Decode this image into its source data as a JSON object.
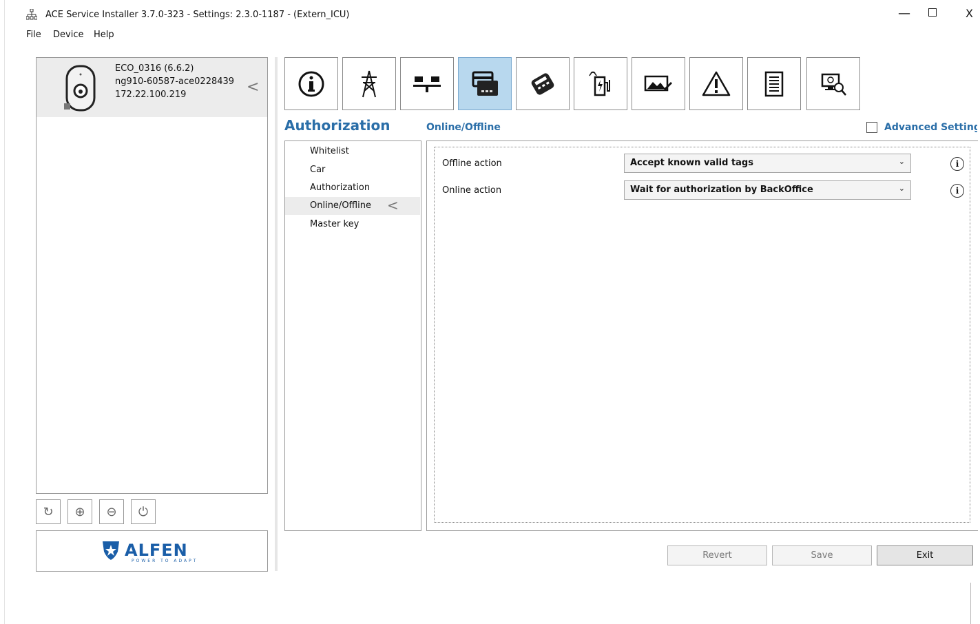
{
  "window": {
    "title": "ACE Service Installer 3.7.0-323 - Settings: 2.3.0-1187 -  (Extern_ICU)",
    "app_icon": "network-icon",
    "minimize": "—",
    "close": "X"
  },
  "menu": [
    "File",
    "Device",
    "Help"
  ],
  "device": {
    "name": "ECO_0316 (6.6.2)",
    "id": "ng910-60587-ace0228439",
    "ip": "172.22.100.219",
    "collapse": "<"
  },
  "device_tools": [
    {
      "icon": "refresh-icon",
      "glyph": "↻"
    },
    {
      "icon": "add-circle-icon",
      "glyph": "⊕"
    },
    {
      "icon": "remove-circle-icon",
      "glyph": "⊖"
    },
    {
      "icon": "power-icon",
      "glyph": "⏻"
    }
  ],
  "logo": {
    "brand": "ALFEN",
    "tagline": "POWER TO ADAPT",
    "color": "#1a5ea8"
  },
  "categories": [
    {
      "icon": "info-icon",
      "selected": false
    },
    {
      "icon": "power-pylon-icon",
      "selected": false
    },
    {
      "icon": "load-balancing-icon",
      "selected": false
    },
    {
      "icon": "card-reader-icon",
      "selected": true
    },
    {
      "icon": "payment-terminal-icon",
      "selected": false
    },
    {
      "icon": "charging-station-icon",
      "selected": false
    },
    {
      "icon": "display-image-icon",
      "selected": false
    },
    {
      "icon": "warning-icon",
      "selected": false
    },
    {
      "icon": "document-icon",
      "selected": false
    },
    {
      "icon": "diagnostics-icon",
      "selected": false
    }
  ],
  "section_title": "Authorization",
  "subsection_title": "Online/Offline",
  "advanced_settings": {
    "label": "Advanced Settings",
    "checked": false
  },
  "subnav": [
    {
      "label": "Whitelist",
      "selected": false
    },
    {
      "label": "Car",
      "selected": false
    },
    {
      "label": "Authorization",
      "selected": false
    },
    {
      "label": "Online/Offline",
      "selected": true
    },
    {
      "label": "Master key",
      "selected": false
    }
  ],
  "subnav_arrow": "<",
  "fields": [
    {
      "label": "Offline action",
      "value": "Accept known valid tags",
      "info": "i"
    },
    {
      "label": "Online action",
      "value": "Wait for authorization by BackOffice",
      "info": "i"
    }
  ],
  "buttons": {
    "revert": "Revert",
    "save": "Save",
    "exit": "Exit"
  },
  "colors": {
    "accent": "#2a6ea8",
    "selected_tab": "#b8d8ee"
  }
}
